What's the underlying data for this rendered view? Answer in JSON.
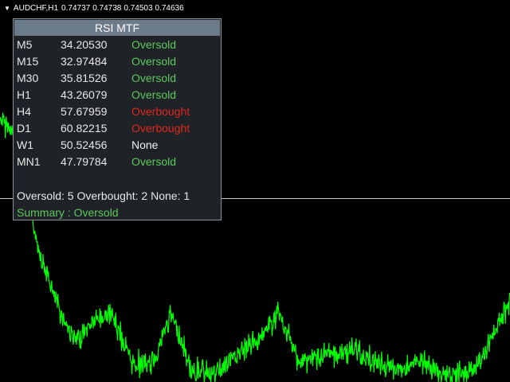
{
  "header": {
    "triangle": "▼",
    "symbol": "AUDCHF,H1",
    "quotes": [
      "0.74737",
      "0.74738",
      "0.74503",
      "0.74636"
    ]
  },
  "colors": {
    "background": "#000000",
    "price_line": "#00ff00",
    "oversold": "#5dc85d",
    "overbought": "#e0261c",
    "none": "#f0f0f0",
    "panel_bg": "#1f2226",
    "panel_title_bg": "#6c7b89"
  },
  "panel": {
    "title": "RSI MTF",
    "rows": [
      {
        "tf": "M5",
        "value": "34.20530",
        "status": "Oversold"
      },
      {
        "tf": "M15",
        "value": "32.97484",
        "status": "Oversold"
      },
      {
        "tf": "M30",
        "value": "35.81526",
        "status": "Oversold"
      },
      {
        "tf": "H1",
        "value": "43.26079",
        "status": "Oversold"
      },
      {
        "tf": "H4",
        "value": "57.67959",
        "status": "Overbought"
      },
      {
        "tf": "D1",
        "value": "60.82215",
        "status": "Overbought"
      },
      {
        "tf": "W1",
        "value": "50.52456",
        "status": "None"
      },
      {
        "tf": "MN1",
        "value": "47.79784",
        "status": "Oversold"
      }
    ],
    "counts": "Oversold: 5  Overbought: 2  None: 1",
    "summary": "Summary : Oversold"
  }
}
